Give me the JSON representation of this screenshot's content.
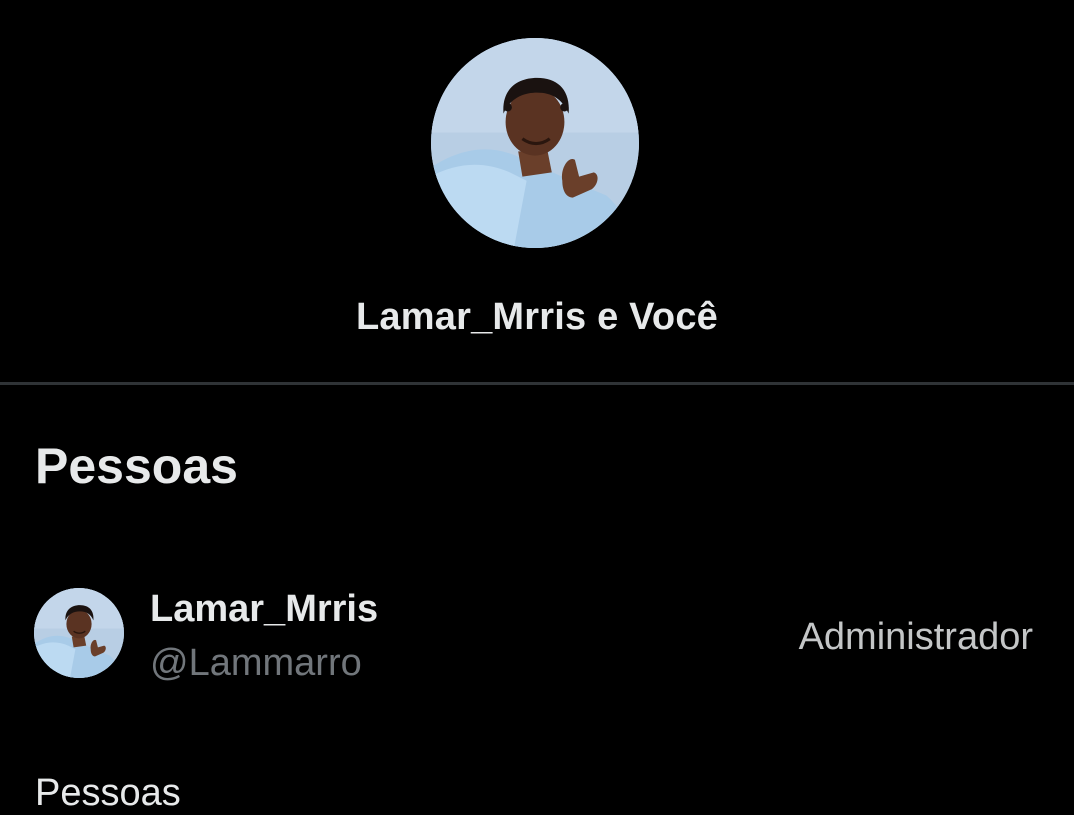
{
  "conversation": {
    "title": "Lamar_Mrris e Você",
    "avatar_icon": "user-photo"
  },
  "people_section": {
    "title": "Pessoas",
    "members": [
      {
        "name": "Lamar_Mrris",
        "handle": "@Lammarro",
        "role": "Administrador",
        "avatar_icon": "user-photo"
      }
    ]
  },
  "next_section": {
    "title": "Pessoas"
  },
  "colors": {
    "background": "#000000",
    "primary_text": "#e7e9ea",
    "secondary_text": "#71767b",
    "divider": "#2f3336"
  }
}
